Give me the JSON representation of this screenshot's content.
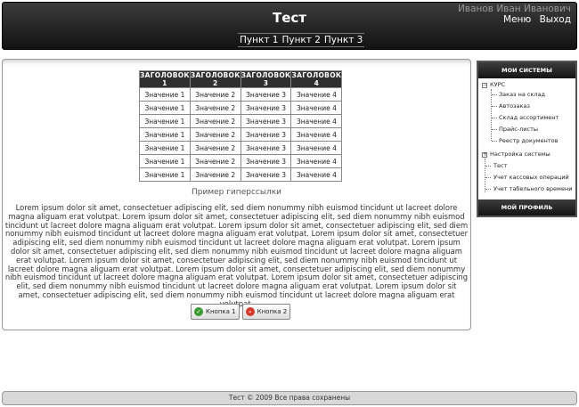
{
  "header": {
    "title": "Тест",
    "user_name": "Иванов Иван Иванович",
    "menu_link": "Меню",
    "logout_link": "Выход",
    "nav": [
      "Пункт 1",
      "Пункт 2",
      "Пункт 3"
    ]
  },
  "table": {
    "headers": [
      "ЗАГОЛОВОК 1",
      "ЗАГОЛОВОК 2",
      "ЗАГОЛОВОК 3",
      "ЗАГОЛОВОК 4"
    ],
    "rows": [
      [
        "Значение 1",
        "Значение 2",
        "Значение 3",
        "Значение 4"
      ],
      [
        "Значение 1",
        "Значение 2",
        "Значение 3",
        "Значение 4"
      ],
      [
        "Значение 1",
        "Значение 2",
        "Значение 3",
        "Значение 4"
      ],
      [
        "Значение 1",
        "Значение 2",
        "Значение 3",
        "Значение 4"
      ],
      [
        "Значение 1",
        "Значение 2",
        "Значение 3",
        "Значение 4"
      ],
      [
        "Значение 1",
        "Значение 2",
        "Значение 3",
        "Значение 4"
      ],
      [
        "Значение 1",
        "Значение 2",
        "Значение 3",
        "Значение 4"
      ]
    ]
  },
  "main": {
    "example_link": "Пример гиперссылки",
    "lorem": "Lorem ipsum dolor sit amet, consectetuer adipiscing elit, sed diem nonummy nibh euismod tincidunt ut lacreet dolore magna aliguam erat volutpat. Lorem ipsum dolor sit amet, consectetuer adipiscing elit, sed diem nonummy nibh euismod tincidunt ut lacreet dolore magna aliguam erat volutpat. Lorem ipsum dolor sit amet, consectetuer adipiscing elit, sed diem nonummy nibh euismod tincidunt ut lacreet dolore magna aliguam erat volutpat. Lorem ipsum dolor sit amet, consectetuer adipiscing elit, sed diem nonummy nibh euismod tincidunt ut lacreet dolore magna aliguam erat volutpat. Lorem ipsum dolor sit amet, consectetuer adipiscing elit, sed diem nonummy nibh euismod tincidunt ut lacreet dolore magna aliguam erat volutpat. Lorem ipsum dolor sit amet, consectetuer adipiscing elit, sed diem nonummy nibh euismod tincidunt ut lacreet dolore magna aliguam erat volutpat. Lorem ipsum dolor sit amet, consectetuer adipiscing elit, sed diem nonummy nibh euismod tincidunt ut lacreet dolore magna aliguam erat volutpat. Lorem ipsum dolor sit amet, consectetuer adipiscing elit, sed diem nonummy nibh euismod tincidunt ut lacreet dolore magna aliguam erat volutpat. Lorem ipsum dolor sit amet, consectetuer adipiscing elit, sed diem nonummy nibh euismod tincidunt ut lacreet dolore magna aliguam erat volutpat.",
    "button1": "Кнопка 1",
    "button2": "Кнопка 2"
  },
  "sidebar": {
    "title": "МОИ СИСТЕМЫ",
    "kurs": "КУРС",
    "kurs_items": [
      "Заказ на склад",
      "Автозаказ",
      "Склад ассортимент",
      "Прайс-листы",
      "Реестр документов"
    ],
    "settings": "Настройка системы",
    "items": [
      "Тест",
      "Учет кассовых операций",
      "Учет табельного времени"
    ],
    "profile": "МОЙ ПРОФИЛЬ"
  },
  "footer": {
    "text": "Тест © 2009 Все права сохранены"
  },
  "colors": {
    "header_bg": "#1e1e1e",
    "footer_bg": "#d8d8d8",
    "ok_icon": "#3a9a32",
    "cancel_icon": "#d23a2a"
  }
}
